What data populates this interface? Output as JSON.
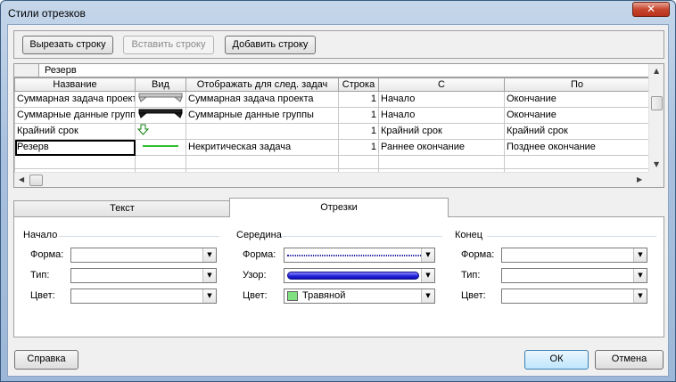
{
  "window": {
    "title": "Стили отрезков",
    "close_label": "✕"
  },
  "toolbar": {
    "cut": "Вырезать строку",
    "paste": "Вставить строку",
    "add": "Добавить строку"
  },
  "grid": {
    "edit_value": "Резерв",
    "columns": [
      "Название",
      "Вид",
      "Отображать для след. задач",
      "Строка",
      "С",
      "По"
    ],
    "rows": [
      {
        "name": "Суммарная задача проект",
        "show_for": "Суммарная задача проекта",
        "row": "1",
        "from": "Начало",
        "to": "Окончание",
        "view": "summary-gray"
      },
      {
        "name": "Суммарные данные групп",
        "show_for": "Суммарные данные группы",
        "row": "1",
        "from": "Начало",
        "to": "Окончание",
        "view": "summary-black"
      },
      {
        "name": "Крайний срок",
        "show_for": "",
        "row": "1",
        "from": "Крайний срок",
        "to": "Крайний срок",
        "view": "deadline-arrow"
      },
      {
        "name": "Резерв",
        "show_for": "Некритическая задача",
        "row": "1",
        "from": "Раннее окончание",
        "to": "Позднее окончание",
        "view": "green-line"
      }
    ]
  },
  "tabs": [
    {
      "label": "Текст"
    },
    {
      "label": "Отрезки"
    }
  ],
  "groups": {
    "start": {
      "title": "Начало",
      "shape_label": "Форма:",
      "type_label": "Тип:",
      "color_label": "Цвет:"
    },
    "middle": {
      "title": "Середина",
      "shape_label": "Форма:",
      "pattern_label": "Узор:",
      "color_label": "Цвет:",
      "color_value": "Травяной",
      "color_hex": "#80e080",
      "bar_color": "#2020d8"
    },
    "end": {
      "title": "Конец",
      "shape_label": "Форма:",
      "type_label": "Тип:",
      "color_label": "Цвет:"
    }
  },
  "footer": {
    "help": "Справка",
    "ok": "ОК",
    "cancel": "Отмена"
  }
}
